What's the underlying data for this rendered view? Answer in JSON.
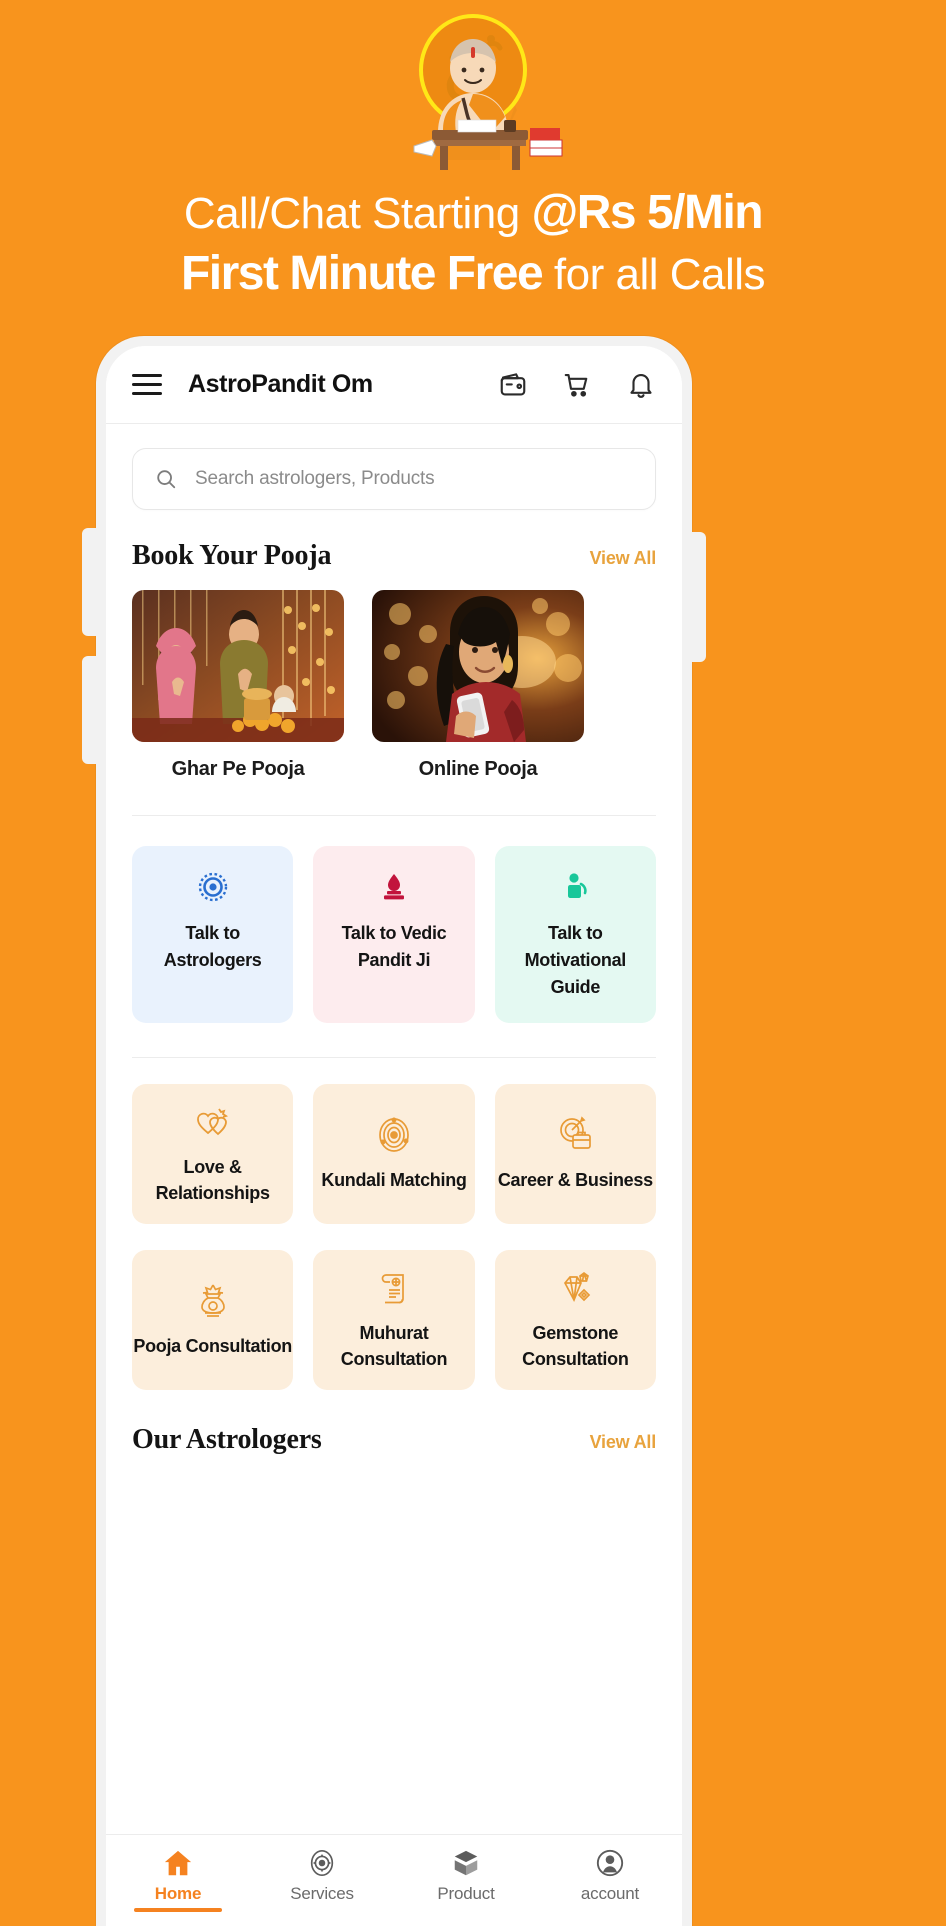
{
  "promo": {
    "line1_normal": "Call/Chat Starting ",
    "line1_strong": "@Rs 5/Min",
    "line2_strong": "First Minute Free",
    "line2_normal": " for all Calls",
    "background_color": "#F8941D",
    "logo_name": "pandit-om-logo"
  },
  "app": {
    "title": "AstroPandit Om",
    "menu_icon": "hamburger-icon",
    "header_icons": [
      "wallet-icon",
      "cart-icon",
      "bell-icon"
    ]
  },
  "search": {
    "placeholder": "Search astrologers, Products",
    "icon": "search-icon"
  },
  "book_pooja": {
    "title": "Book Your Pooja",
    "view_all": "View All",
    "cards": [
      {
        "label": "Ghar Pe Pooja",
        "image": "couple-praying-photo"
      },
      {
        "label": "Online Pooja",
        "image": "woman-on-phone-photo"
      }
    ]
  },
  "talk_to": [
    {
      "label": "Talk to Astrologers",
      "bg": "#E9F2FD",
      "icon": "chakra-icon",
      "color": "#2A6FD0"
    },
    {
      "label": "Talk to Vedic Pandit Ji",
      "bg": "#FDECEE",
      "icon": "havan-fire-icon",
      "color": "#C2143C"
    },
    {
      "label": "Talk to Motivational Guide",
      "bg": "#E4F9F2",
      "icon": "speaker-person-icon",
      "color": "#18C79A"
    }
  ],
  "services": [
    {
      "label": "Love & Relationships",
      "icon": "two-hearts-icon"
    },
    {
      "label": "Kundali Matching",
      "icon": "kundali-chart-icon"
    },
    {
      "label": "Career & Business",
      "icon": "briefcase-target-icon"
    },
    {
      "label": "Pooja Consultation",
      "icon": "kalash-icon"
    },
    {
      "label": "Muhurat Consultation",
      "icon": "scroll-icon"
    },
    {
      "label": "Gemstone Consultation",
      "icon": "gemstones-icon"
    }
  ],
  "our_astrologers": {
    "title": "Our Astrologers",
    "view_all": "View All"
  },
  "bottom_nav": [
    {
      "label": "Home",
      "icon": "home-icon",
      "active": true
    },
    {
      "label": "Services",
      "icon": "services-icon",
      "active": false
    },
    {
      "label": "Product",
      "icon": "box-icon",
      "active": false
    },
    {
      "label": "account",
      "icon": "account-icon",
      "active": false
    }
  ],
  "colors": {
    "brand_orange": "#F8941D",
    "accent_gold": "#E8A33D",
    "tile_cream": "#FCEEDC"
  }
}
